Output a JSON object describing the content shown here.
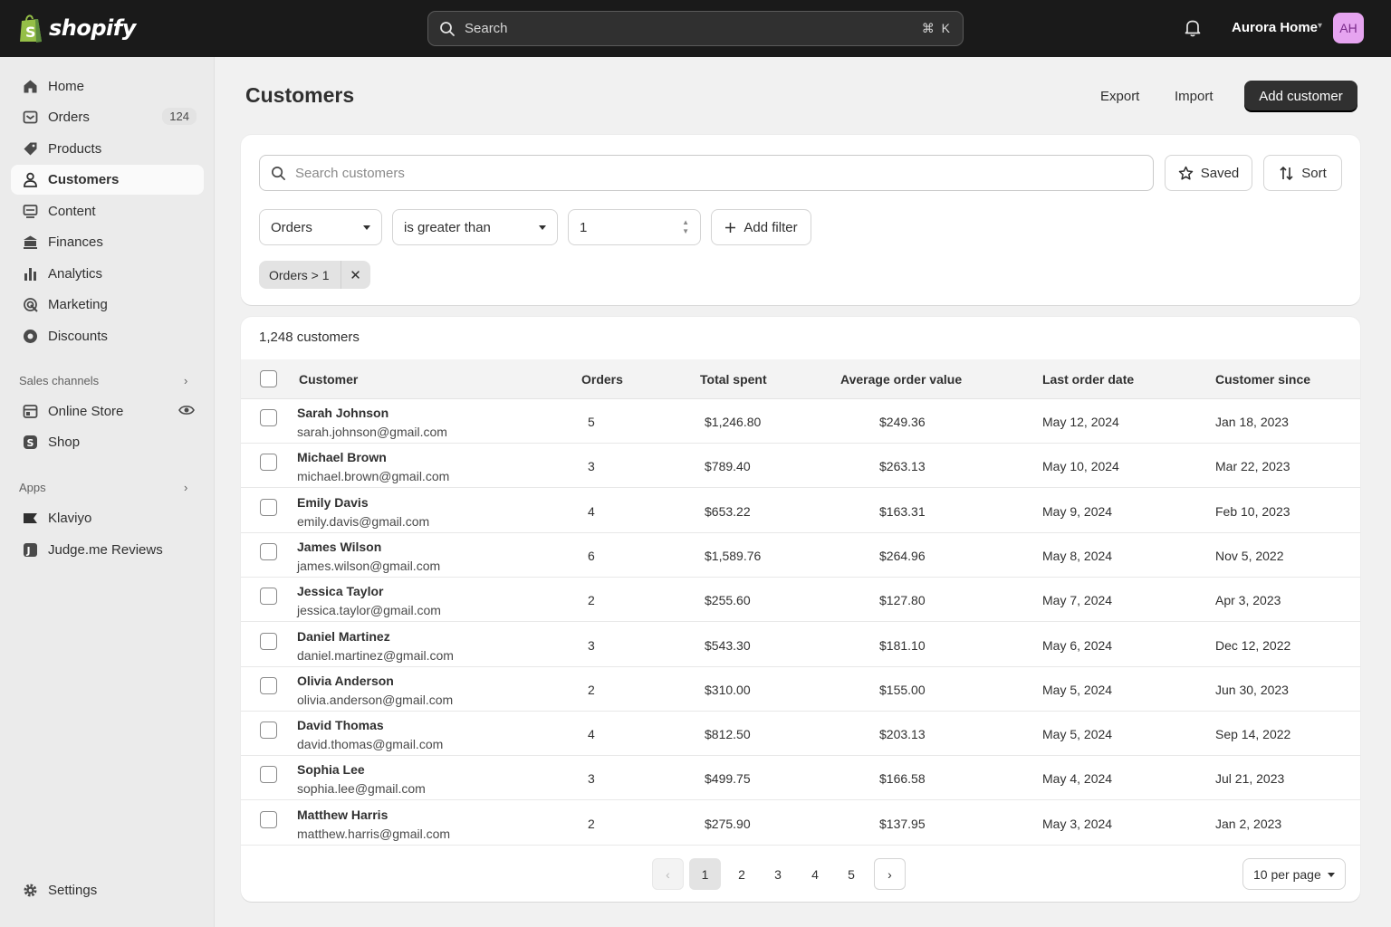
{
  "topbar": {
    "brand": "shopify",
    "search_placeholder": "Search",
    "shortcut": "⌘ K",
    "store_name": "Aurora Home",
    "avatar_initials": "AH"
  },
  "sidebar": {
    "items": [
      {
        "label": "Home",
        "icon": "home-icon"
      },
      {
        "label": "Orders",
        "icon": "orders-icon",
        "badge": "124"
      },
      {
        "label": "Products",
        "icon": "tag-icon"
      },
      {
        "label": "Customers",
        "icon": "person-icon",
        "active": true
      },
      {
        "label": "Content",
        "icon": "content-icon"
      },
      {
        "label": "Finances",
        "icon": "bank-icon"
      },
      {
        "label": "Analytics",
        "icon": "bar-chart-icon"
      },
      {
        "label": "Marketing",
        "icon": "target-icon"
      },
      {
        "label": "Discounts",
        "icon": "discount-icon"
      }
    ],
    "sales_channels_label": "Sales channels",
    "channels": [
      {
        "label": "Online Store",
        "icon": "store-icon"
      },
      {
        "label": "Shop",
        "icon": "shop-icon"
      }
    ],
    "apps_label": "Apps",
    "apps": [
      {
        "label": "Klaviyo",
        "icon": "klaviyo-icon"
      },
      {
        "label": "Judge.me Reviews",
        "icon": "judgeme-icon"
      }
    ],
    "settings_label": "Settings"
  },
  "header": {
    "title": "Customers",
    "export_label": "Export",
    "import_label": "Import",
    "add_label": "Add customer"
  },
  "filters": {
    "search_placeholder": "Search customers",
    "saved_label": "Saved",
    "sort_label": "Sort",
    "field": "Orders",
    "operator": "is greater than",
    "value": "1",
    "add_filter_label": "Add filter",
    "chip_label": "Orders > 1"
  },
  "table": {
    "count_label": "1,248 customers",
    "columns": [
      "Customer",
      "Orders",
      "Total spent",
      "Average order value",
      "Last order date",
      "Customer since"
    ],
    "rows": [
      {
        "name": "Sarah Johnson",
        "email": "sarah.johnson@gmail.com",
        "orders": "5",
        "total": "$1,246.80",
        "aov": "$249.36",
        "last": "May 12, 2024",
        "since": "Jan 18, 2023"
      },
      {
        "name": "Michael Brown",
        "email": "michael.brown@gmail.com",
        "orders": "3",
        "total": "$789.40",
        "aov": "$263.13",
        "last": "May 10, 2024",
        "since": "Mar 22, 2023"
      },
      {
        "name": "Emily Davis",
        "email": "emily.davis@gmail.com",
        "orders": "4",
        "total": "$653.22",
        "aov": "$163.31",
        "last": "May 9, 2024",
        "since": "Feb 10, 2023"
      },
      {
        "name": "James Wilson",
        "email": "james.wilson@gmail.com",
        "orders": "6",
        "total": "$1,589.76",
        "aov": "$264.96",
        "last": "May 8, 2024",
        "since": "Nov 5, 2022"
      },
      {
        "name": "Jessica Taylor",
        "email": "jessica.taylor@gmail.com",
        "orders": "2",
        "total": "$255.60",
        "aov": "$127.80",
        "last": "May 7, 2024",
        "since": "Apr 3, 2023"
      },
      {
        "name": "Daniel Martinez",
        "email": "daniel.martinez@gmail.com",
        "orders": "3",
        "total": "$543.30",
        "aov": "$181.10",
        "last": "May 6, 2024",
        "since": "Dec 12, 2022"
      },
      {
        "name": "Olivia Anderson",
        "email": "olivia.anderson@gmail.com",
        "orders": "2",
        "total": "$310.00",
        "aov": "$155.00",
        "last": "May 5, 2024",
        "since": "Jun 30, 2023"
      },
      {
        "name": "David Thomas",
        "email": "david.thomas@gmail.com",
        "orders": "4",
        "total": "$812.50",
        "aov": "$203.13",
        "last": "May 5, 2024",
        "since": "Sep 14, 2022"
      },
      {
        "name": "Sophia Lee",
        "email": "sophia.lee@gmail.com",
        "orders": "3",
        "total": "$499.75",
        "aov": "$166.58",
        "last": "May 4, 2024",
        "since": "Jul 21, 2023"
      },
      {
        "name": "Matthew Harris",
        "email": "matthew.harris@gmail.com",
        "orders": "2",
        "total": "$275.90",
        "aov": "$137.95",
        "last": "May 3, 2024",
        "since": "Jan 2, 2023"
      }
    ]
  },
  "pagination": {
    "pages": [
      "1",
      "2",
      "3",
      "4",
      "5"
    ],
    "current": "1",
    "per_page": "10 per page"
  },
  "colors": {
    "topbar": "#1a1a1a",
    "primary_button": "#303030",
    "avatar": "#e6a4f0",
    "logo_green": "#95bf47"
  }
}
